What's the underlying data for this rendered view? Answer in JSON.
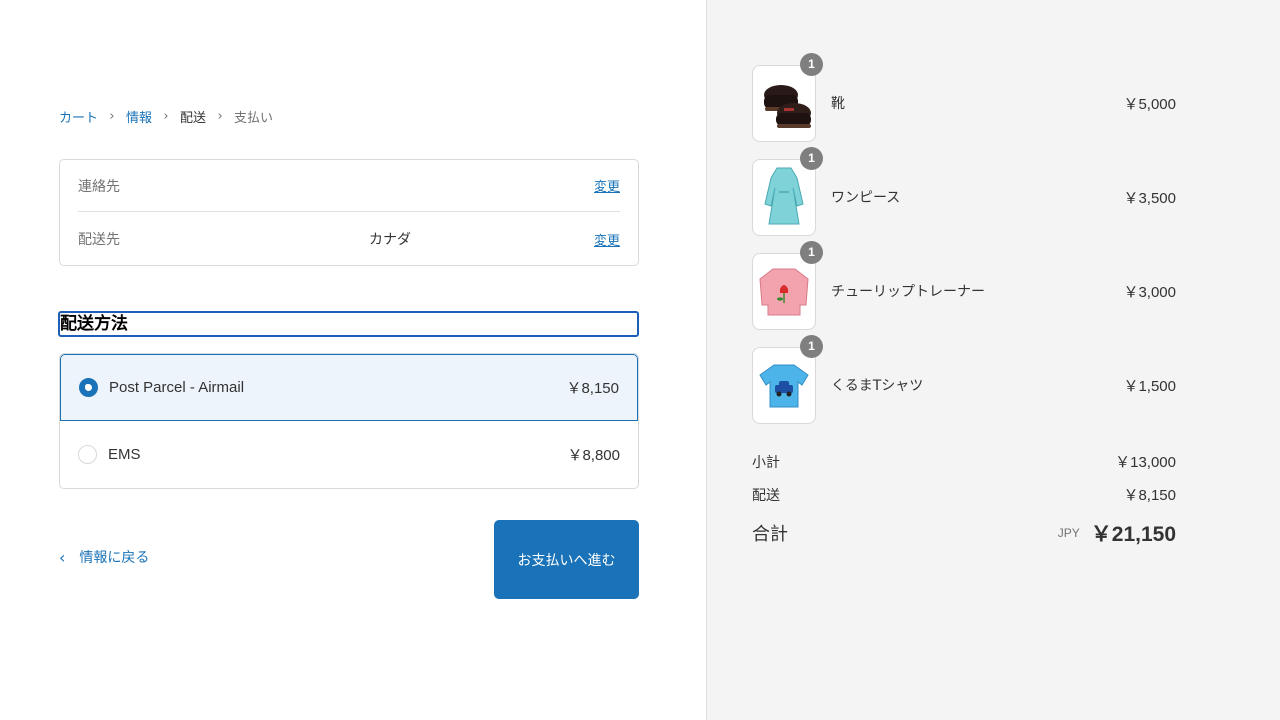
{
  "breadcrumb": {
    "cart": "カート",
    "info": "情報",
    "shipping": "配送",
    "payment": "支払い"
  },
  "review": {
    "contact_label": "連絡先",
    "contact_value": "",
    "contact_change": "変更",
    "shipto_label": "配送先",
    "shipto_value": "カナダ",
    "shipto_change": "変更"
  },
  "shipping_method": {
    "title": "配送方法",
    "options": [
      {
        "name": "Post Parcel - Airmail",
        "price": "￥8,150",
        "selected": true
      },
      {
        "name": "EMS",
        "price": "￥8,800",
        "selected": false
      }
    ]
  },
  "actions": {
    "back": "情報に戻る",
    "continue": "お支払いへ進む"
  },
  "cart": {
    "items": [
      {
        "name": "靴",
        "price": "￥5,000",
        "quantity": "1",
        "icon": "shoes-icon"
      },
      {
        "name": "ワンピース",
        "price": "￥3,500",
        "quantity": "1",
        "icon": "dress-icon"
      },
      {
        "name": "チューリップトレーナー",
        "price": "￥3,000",
        "quantity": "1",
        "icon": "sweater-icon"
      },
      {
        "name": "くるまTシャツ",
        "price": "￥1,500",
        "quantity": "1",
        "icon": "tshirt-icon"
      }
    ],
    "subtotal_label": "小計",
    "subtotal_value": "￥13,000",
    "shipping_label": "配送",
    "shipping_value": "￥8,150",
    "total_label": "合計",
    "currency": "JPY",
    "total_value": "￥21,150"
  },
  "colors": {
    "accent": "#1a73b8",
    "sidebar_bg": "#f4f4f4",
    "selected_bg": "#eef4fc"
  }
}
